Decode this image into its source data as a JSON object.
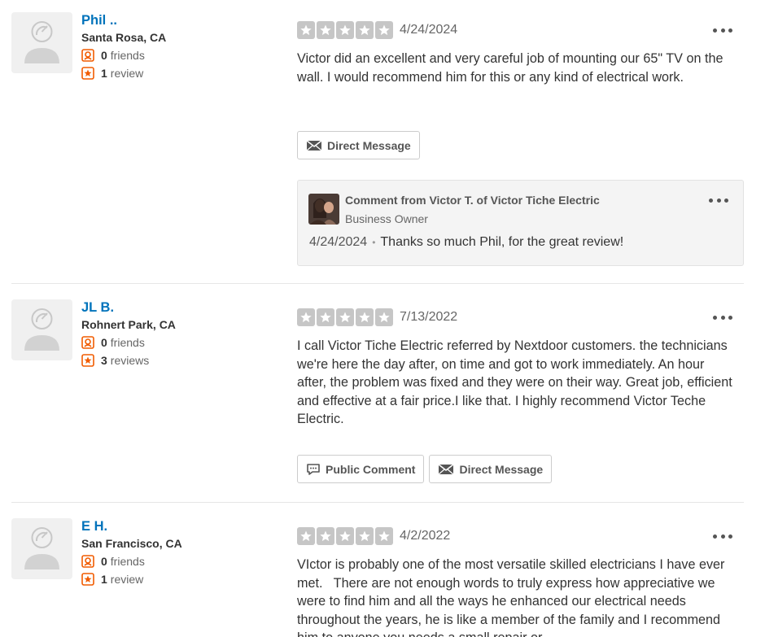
{
  "reviews": [
    {
      "user": {
        "name": "Phil ..",
        "location": "Santa Rosa, CA",
        "friends_count": "0",
        "friends_label": "friends",
        "reviews_count": "1",
        "reviews_label": "review"
      },
      "rating": 5,
      "date": "4/24/2024",
      "text": "Victor did an excellent and very careful job of mounting our 65\" TV on the wall. I would recommend him for this or any kind of electrical work.",
      "buttons": {
        "direct_message": "Direct Message"
      },
      "owner_comment": {
        "title": "Comment from Victor T. of Victor Tiche Electric",
        "role": "Business Owner",
        "date": "4/24/2024",
        "separator": "•",
        "text": "Thanks so much Phil, for the great review!"
      }
    },
    {
      "user": {
        "name": "JL B.",
        "location": "Rohnert Park, CA",
        "friends_count": "0",
        "friends_label": "friends",
        "reviews_count": "3",
        "reviews_label": "reviews"
      },
      "rating": 5,
      "date": "7/13/2022",
      "text": "I call Victor Tiche Electric referred by Nextdoor customers. the technicians we're here the day after, on time and got to work immediately. An hour after, the problem was fixed and they were on their way. Great job, efficient and effective at a fair price.I like that. I highly recommend Victor Teche Electric.",
      "buttons": {
        "public_comment": "Public Comment",
        "direct_message": "Direct Message"
      }
    },
    {
      "user": {
        "name": "E H.",
        "location": "San Francisco, CA",
        "friends_count": "0",
        "friends_label": "friends",
        "reviews_count": "1",
        "reviews_label": "review"
      },
      "rating": 5,
      "date": "4/2/2022",
      "text": "VIctor is probably one of the most versatile skilled electricians I have ever met.   There are not enough words to truly express how appreciative we were to find him and all the ways he enhanced our electrical needs throughout the years, he is like a member of the family and I recommend him to anyone you needs a small repair or"
    }
  ],
  "colors": {
    "user_link": "#0073bb",
    "star_empty": "#c6c6c6",
    "stat_icon": "#f15c00"
  },
  "icons": {
    "avatar": "default-user-avatar-icon",
    "friends": "friends-icon",
    "reviews": "review-star-icon",
    "message": "envelope-icon",
    "comment": "speech-bubble-icon",
    "more": "more-horizontal-icon"
  }
}
